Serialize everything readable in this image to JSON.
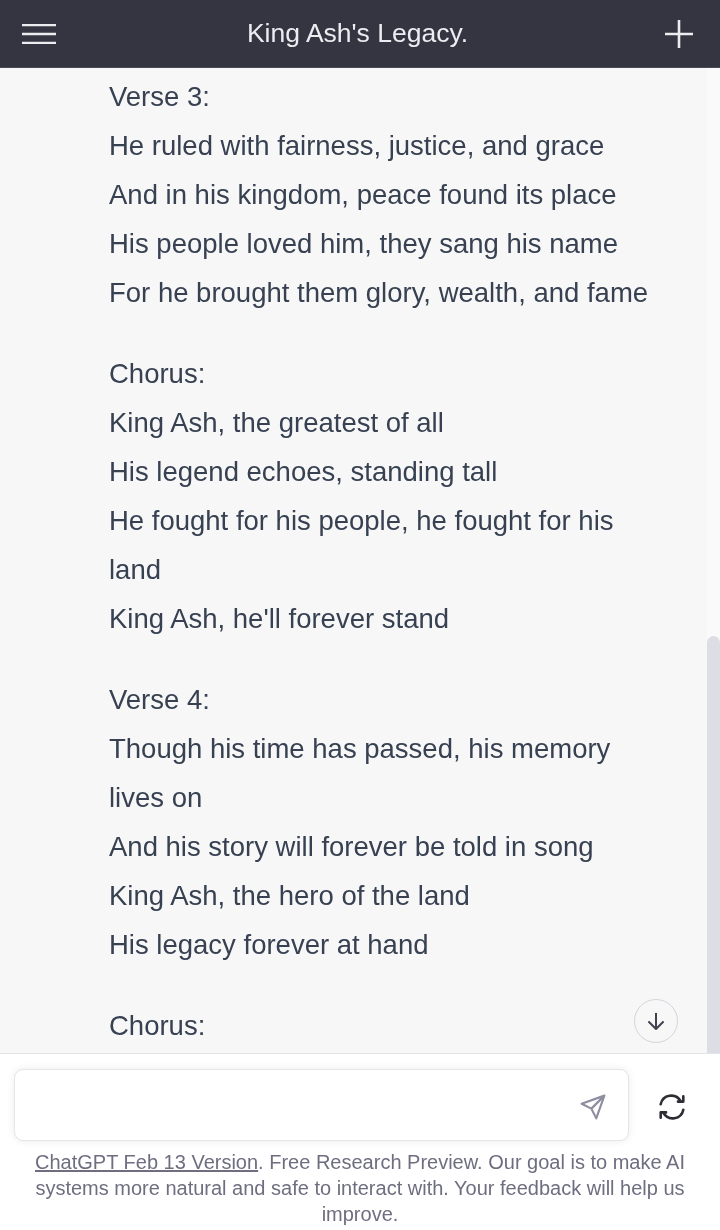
{
  "header": {
    "title": "King Ash's Legacy."
  },
  "message": {
    "stanzas": [
      {
        "heading": "Verse 3:",
        "lines": [
          "He ruled with fairness, justice, and grace",
          "And in his kingdom, peace found its place",
          "His people loved him, they sang his name",
          "For he brought them glory, wealth, and fame"
        ]
      },
      {
        "heading": "Chorus:",
        "lines": [
          "King Ash, the greatest of all",
          "His legend echoes, standing tall",
          "He fought for his people, he fought for his land",
          "King Ash, he'll forever stand"
        ]
      },
      {
        "heading": "Verse 4:",
        "lines": [
          "Though his time has passed, his memory lives on",
          "And his story will forever be told in song",
          "King Ash, the hero of the land",
          "His legacy forever at hand"
        ]
      },
      {
        "heading": "Chorus:"
      }
    ]
  },
  "footer": {
    "link": "ChatGPT Feb 13 Version",
    "text": ". Free Research Preview. Our goal is to make AI systems more natural and safe to interact with. Your feedback will help us improve."
  }
}
